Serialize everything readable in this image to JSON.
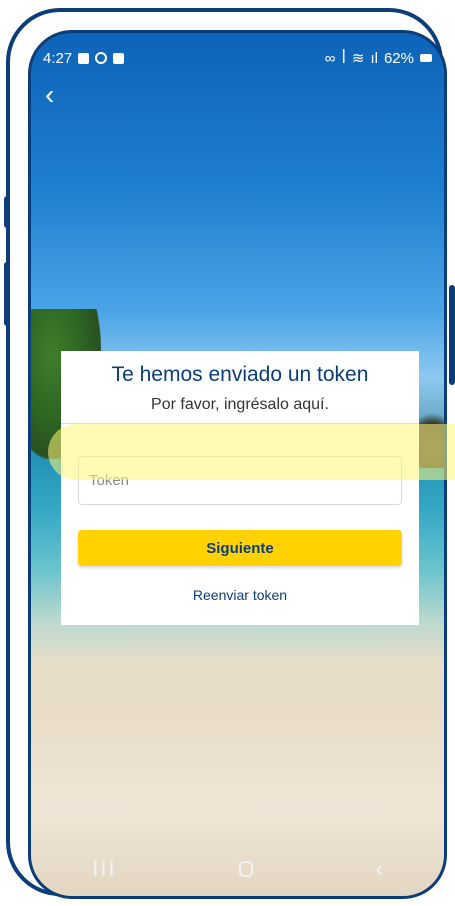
{
  "status_bar": {
    "time": "4:27",
    "battery_percent": "62%",
    "indicators": [
      "image-icon",
      "circle-icon",
      "checkbox-icon",
      "link-icon",
      "mute-icon",
      "wifi-icon",
      "signal-icon",
      "battery-icon"
    ]
  },
  "navigation": {
    "back_icon": "‹"
  },
  "card": {
    "title": "Te hemos enviado un token",
    "subtitle": "Por favor, ingrésalo aquí.",
    "token_placeholder": "Token",
    "token_value": "",
    "next_label": "Siguiente",
    "resend_label": "Reenviar token"
  },
  "system_nav": {
    "recent": "III",
    "back": "‹"
  },
  "colors": {
    "brand_blue": "#0b3d7a",
    "button_yellow": "#ffd200",
    "highlight": "#fff778"
  }
}
